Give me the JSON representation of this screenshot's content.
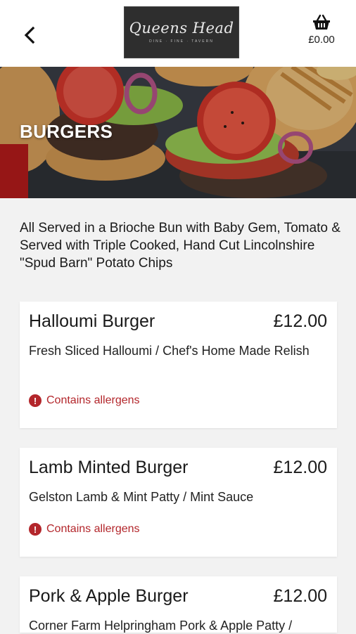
{
  "header": {
    "back_icon": "chevron-left-icon",
    "logo_text": "Queens Head",
    "logo_subtext": "DINE · FINE · TAVERN",
    "basket_icon": "basket-icon",
    "basket_total": "£0.00"
  },
  "hero": {
    "title": "BURGERS"
  },
  "intro": "All Served in a Brioche Bun with Baby Gem, Tomato & Served with Triple Cooked, Hand Cut Lincolnshire \"Spud Barn\" Potato Chips",
  "items": [
    {
      "name": "Halloumi Burger",
      "price": "£12.00",
      "description": "Fresh Sliced Halloumi / Chef's Home Made Relish",
      "allergen_text": "Contains allergens"
    },
    {
      "name": "Lamb Minted Burger",
      "price": "£12.00",
      "description": "Gelston Lamb & Mint Patty / Mint Sauce",
      "allergen_text": "Contains allergens"
    },
    {
      "name": "Pork & Apple Burger",
      "price": "£12.00",
      "description": "Corner Farm Helpringham Pork & Apple Patty /"
    }
  ],
  "colors": {
    "allergen": "#b3262b",
    "background": "#f2f2f2"
  }
}
